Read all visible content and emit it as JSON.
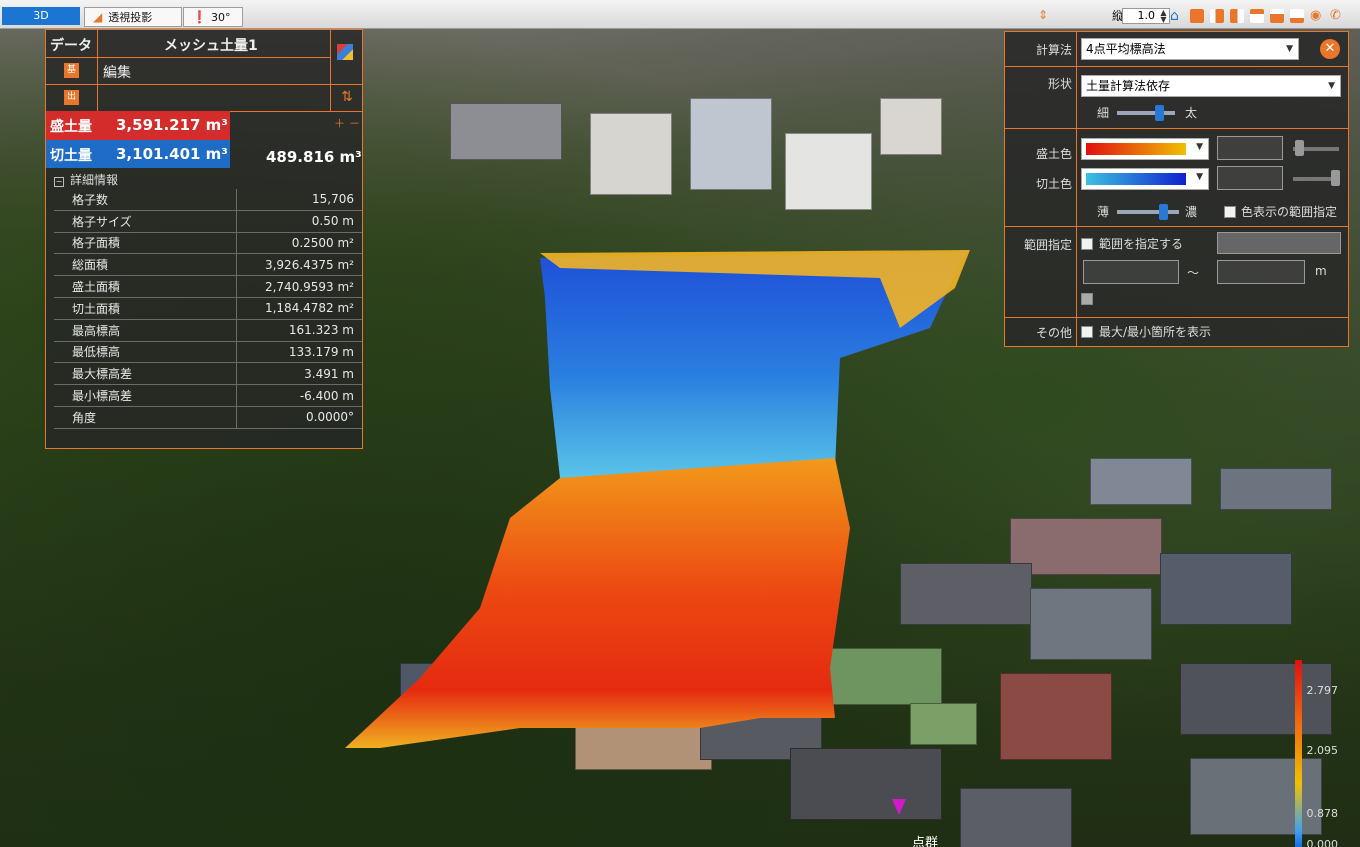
{
  "toolbar": {
    "view_tab": "3D",
    "projection_label": "透視投影",
    "angle_label": "30°",
    "scale_label": "縦倍率:",
    "scale_value": "1.0",
    "icons": [
      "ruler-icon",
      "home-icon",
      "view-front-icon",
      "view-right-icon",
      "view-left-icon",
      "view-top-icon",
      "view-back-icon",
      "view-bottom-icon",
      "camera-icon",
      "phone-icon"
    ]
  },
  "data_panel": {
    "header_key": "データ",
    "title": "メッシュ土量1",
    "edit_label": "編集",
    "base_icon": "基",
    "out_icon": "出",
    "fill_label": "盛土量",
    "fill_value": "3,591.217 m³",
    "cut_label": "切土量",
    "cut_value": "3,101.401 m³",
    "net_value": "489.816 m³",
    "detail_header": "詳細情報",
    "details": [
      {
        "key": "格子数",
        "value": "15,706"
      },
      {
        "key": "格子サイズ",
        "value": "0.50 m"
      },
      {
        "key": "格子面積",
        "value": "0.2500 m²"
      },
      {
        "key": "総面積",
        "value": "3,926.4375 m²"
      },
      {
        "key": "盛土面積",
        "value": "2,740.9593 m²"
      },
      {
        "key": "切土面積",
        "value": "1,184.4782 m²"
      },
      {
        "key": "最高標高",
        "value": "161.323 m"
      },
      {
        "key": "最低標高",
        "value": "133.179 m"
      },
      {
        "key": "最大標高差",
        "value": "3.491 m"
      },
      {
        "key": "最小標高差",
        "value": "-6.400 m"
      },
      {
        "key": "角度",
        "value": "0.0000°"
      }
    ]
  },
  "settings": {
    "calc_label": "計算法",
    "calc_value": "4点平均標高法",
    "shape_label": "形状",
    "shape_value": "土量計算法依存",
    "thin_label": "細",
    "thick_label": "太",
    "fill_color_label": "盛土色",
    "cut_color_label": "切土色",
    "light_label": "薄",
    "dark_label": "濃",
    "color_range_label": "色表示の範囲指定",
    "range_label": "範囲指定",
    "range_check_label": "範囲を指定する",
    "range_unit": "m",
    "range_sep": "～",
    "other_label": "その他",
    "other_check_label": "最大/最小箇所を表示",
    "fill_gradient": [
      "#e01010",
      "#f0c000"
    ],
    "cut_gradient": [
      "#3cc0e0",
      "#1020d0"
    ]
  },
  "scale_bar": {
    "labels": [
      "2.797",
      "2.095",
      "0.878",
      "0.000"
    ]
  },
  "scene": {
    "marker_label": "点群"
  }
}
